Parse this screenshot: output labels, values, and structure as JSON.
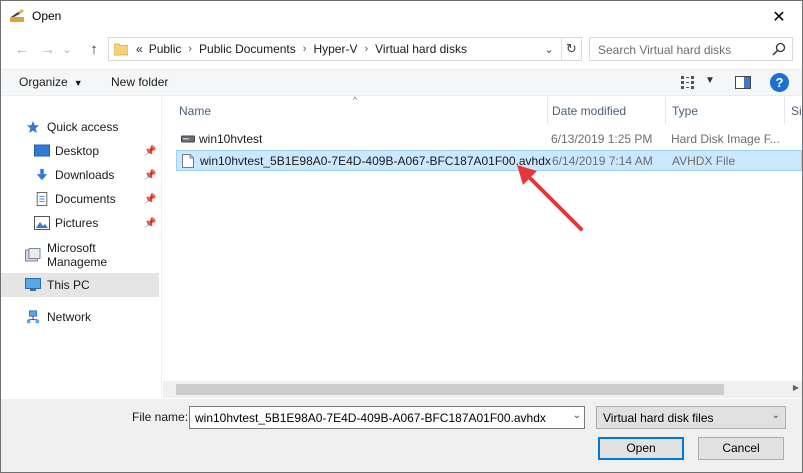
{
  "window": {
    "title": "Open",
    "close_glyph": "✕"
  },
  "nav": {
    "back_glyph": "←",
    "forward_glyph": "→",
    "recent_glyph": "⌄",
    "up_glyph": "↑"
  },
  "address": {
    "overflow": "«",
    "crumbs": [
      "Public",
      "Public Documents",
      "Hyper-V",
      "Virtual hard disks"
    ],
    "separator": "›",
    "dropdown_glyph": "⌄",
    "refresh_glyph": "↻"
  },
  "search": {
    "placeholder": "Search Virtual hard disks"
  },
  "toolbar": {
    "organize_label": "Organize",
    "organize_caret": "▼",
    "new_folder_label": "New folder",
    "view_caret": "▼",
    "help_label": "?"
  },
  "sidebar": {
    "items": [
      {
        "label": "Quick access",
        "icon": "star-icon",
        "pinned": false
      },
      {
        "label": "Desktop",
        "icon": "desktop-icon",
        "pinned": true
      },
      {
        "label": "Downloads",
        "icon": "download-icon",
        "pinned": true
      },
      {
        "label": "Documents",
        "icon": "documents-icon",
        "pinned": true
      },
      {
        "label": "Pictures",
        "icon": "pictures-icon",
        "pinned": true
      },
      {
        "label": "Microsoft Manageme",
        "icon": "cloud-folder-icon",
        "pinned": false
      },
      {
        "label": "This PC",
        "icon": "computer-icon",
        "pinned": false,
        "selected": true
      },
      {
        "label": "Network",
        "icon": "network-icon",
        "pinned": false
      }
    ],
    "pin_glyph": "📌"
  },
  "file_list": {
    "columns": [
      "Name",
      "Date modified",
      "Type",
      "Siz"
    ],
    "sort_glyph": "^",
    "rows": [
      {
        "name": "win10hvtest",
        "date": "6/13/2019 1:25 PM",
        "type": "Hard Disk Image F...",
        "icon": "disk-image-icon",
        "selected": false
      },
      {
        "name": "win10hvtest_5B1E98A0-7E4D-409B-A067-BFC187A01F00.avhdx",
        "date": "6/14/2019 7:14 AM",
        "type": "AVHDX File",
        "icon": "generic-file-icon",
        "selected": true
      }
    ]
  },
  "footer": {
    "file_name_label": "File name:",
    "file_name_value": "win10hvtest_5B1E98A0-7E4D-409B-A067-BFC187A01F00.avhdx",
    "filter_value": "Virtual hard disk files",
    "dropdown_glyph": "⌄",
    "open_label": "Open",
    "cancel_label": "Cancel"
  },
  "colors": {
    "accent": "#0078d7",
    "selection": "#cce8ff",
    "annotation_arrow": "#e8373a"
  }
}
